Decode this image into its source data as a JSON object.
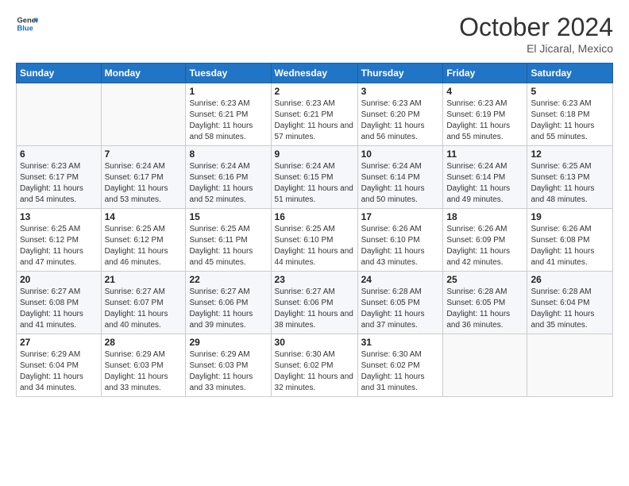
{
  "header": {
    "logo_line1": "General",
    "logo_line2": "Blue",
    "title": "October 2024",
    "location": "El Jicaral, Mexico"
  },
  "days_of_week": [
    "Sunday",
    "Monday",
    "Tuesday",
    "Wednesday",
    "Thursday",
    "Friday",
    "Saturday"
  ],
  "weeks": [
    [
      {
        "day": "",
        "info": ""
      },
      {
        "day": "",
        "info": ""
      },
      {
        "day": "1",
        "info": "Sunrise: 6:23 AM\nSunset: 6:21 PM\nDaylight: 11 hours and 58 minutes."
      },
      {
        "day": "2",
        "info": "Sunrise: 6:23 AM\nSunset: 6:21 PM\nDaylight: 11 hours and 57 minutes."
      },
      {
        "day": "3",
        "info": "Sunrise: 6:23 AM\nSunset: 6:20 PM\nDaylight: 11 hours and 56 minutes."
      },
      {
        "day": "4",
        "info": "Sunrise: 6:23 AM\nSunset: 6:19 PM\nDaylight: 11 hours and 55 minutes."
      },
      {
        "day": "5",
        "info": "Sunrise: 6:23 AM\nSunset: 6:18 PM\nDaylight: 11 hours and 55 minutes."
      }
    ],
    [
      {
        "day": "6",
        "info": "Sunrise: 6:23 AM\nSunset: 6:17 PM\nDaylight: 11 hours and 54 minutes."
      },
      {
        "day": "7",
        "info": "Sunrise: 6:24 AM\nSunset: 6:17 PM\nDaylight: 11 hours and 53 minutes."
      },
      {
        "day": "8",
        "info": "Sunrise: 6:24 AM\nSunset: 6:16 PM\nDaylight: 11 hours and 52 minutes."
      },
      {
        "day": "9",
        "info": "Sunrise: 6:24 AM\nSunset: 6:15 PM\nDaylight: 11 hours and 51 minutes."
      },
      {
        "day": "10",
        "info": "Sunrise: 6:24 AM\nSunset: 6:14 PM\nDaylight: 11 hours and 50 minutes."
      },
      {
        "day": "11",
        "info": "Sunrise: 6:24 AM\nSunset: 6:14 PM\nDaylight: 11 hours and 49 minutes."
      },
      {
        "day": "12",
        "info": "Sunrise: 6:25 AM\nSunset: 6:13 PM\nDaylight: 11 hours and 48 minutes."
      }
    ],
    [
      {
        "day": "13",
        "info": "Sunrise: 6:25 AM\nSunset: 6:12 PM\nDaylight: 11 hours and 47 minutes."
      },
      {
        "day": "14",
        "info": "Sunrise: 6:25 AM\nSunset: 6:12 PM\nDaylight: 11 hours and 46 minutes."
      },
      {
        "day": "15",
        "info": "Sunrise: 6:25 AM\nSunset: 6:11 PM\nDaylight: 11 hours and 45 minutes."
      },
      {
        "day": "16",
        "info": "Sunrise: 6:25 AM\nSunset: 6:10 PM\nDaylight: 11 hours and 44 minutes."
      },
      {
        "day": "17",
        "info": "Sunrise: 6:26 AM\nSunset: 6:10 PM\nDaylight: 11 hours and 43 minutes."
      },
      {
        "day": "18",
        "info": "Sunrise: 6:26 AM\nSunset: 6:09 PM\nDaylight: 11 hours and 42 minutes."
      },
      {
        "day": "19",
        "info": "Sunrise: 6:26 AM\nSunset: 6:08 PM\nDaylight: 11 hours and 41 minutes."
      }
    ],
    [
      {
        "day": "20",
        "info": "Sunrise: 6:27 AM\nSunset: 6:08 PM\nDaylight: 11 hours and 41 minutes."
      },
      {
        "day": "21",
        "info": "Sunrise: 6:27 AM\nSunset: 6:07 PM\nDaylight: 11 hours and 40 minutes."
      },
      {
        "day": "22",
        "info": "Sunrise: 6:27 AM\nSunset: 6:06 PM\nDaylight: 11 hours and 39 minutes."
      },
      {
        "day": "23",
        "info": "Sunrise: 6:27 AM\nSunset: 6:06 PM\nDaylight: 11 hours and 38 minutes."
      },
      {
        "day": "24",
        "info": "Sunrise: 6:28 AM\nSunset: 6:05 PM\nDaylight: 11 hours and 37 minutes."
      },
      {
        "day": "25",
        "info": "Sunrise: 6:28 AM\nSunset: 6:05 PM\nDaylight: 11 hours and 36 minutes."
      },
      {
        "day": "26",
        "info": "Sunrise: 6:28 AM\nSunset: 6:04 PM\nDaylight: 11 hours and 35 minutes."
      }
    ],
    [
      {
        "day": "27",
        "info": "Sunrise: 6:29 AM\nSunset: 6:04 PM\nDaylight: 11 hours and 34 minutes."
      },
      {
        "day": "28",
        "info": "Sunrise: 6:29 AM\nSunset: 6:03 PM\nDaylight: 11 hours and 33 minutes."
      },
      {
        "day": "29",
        "info": "Sunrise: 6:29 AM\nSunset: 6:03 PM\nDaylight: 11 hours and 33 minutes."
      },
      {
        "day": "30",
        "info": "Sunrise: 6:30 AM\nSunset: 6:02 PM\nDaylight: 11 hours and 32 minutes."
      },
      {
        "day": "31",
        "info": "Sunrise: 6:30 AM\nSunset: 6:02 PM\nDaylight: 11 hours and 31 minutes."
      },
      {
        "day": "",
        "info": ""
      },
      {
        "day": "",
        "info": ""
      }
    ]
  ]
}
